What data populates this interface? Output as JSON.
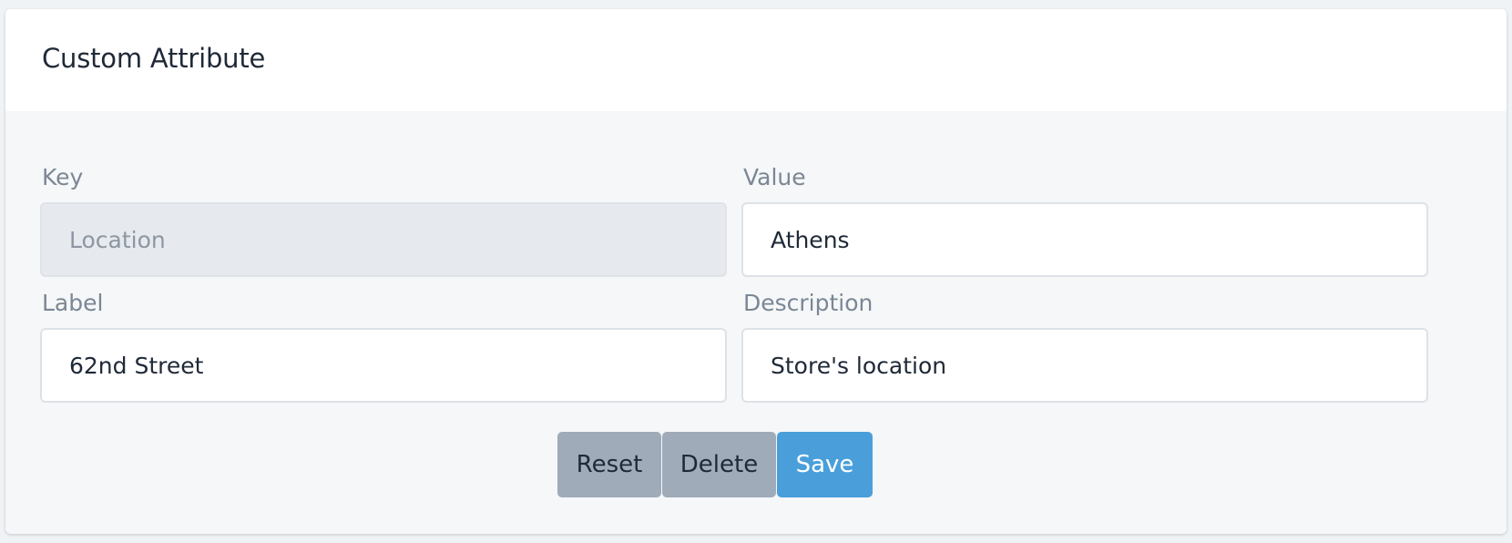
{
  "card": {
    "title": "Custom Attribute"
  },
  "form": {
    "key": {
      "label": "Key",
      "value": "Location",
      "disabled": true
    },
    "value": {
      "label": "Value",
      "value": "Athens"
    },
    "label": {
      "label": "Label",
      "value": "62nd Street"
    },
    "description": {
      "label": "Description",
      "value": "Store's location"
    }
  },
  "actions": {
    "reset_label": "Reset",
    "delete_label": "Delete",
    "save_label": "Save"
  },
  "colors": {
    "primary": "#4a9fdb",
    "secondary": "#a0abb9",
    "label": "#7b8794",
    "disabled_bg": "#e6e9ed"
  }
}
